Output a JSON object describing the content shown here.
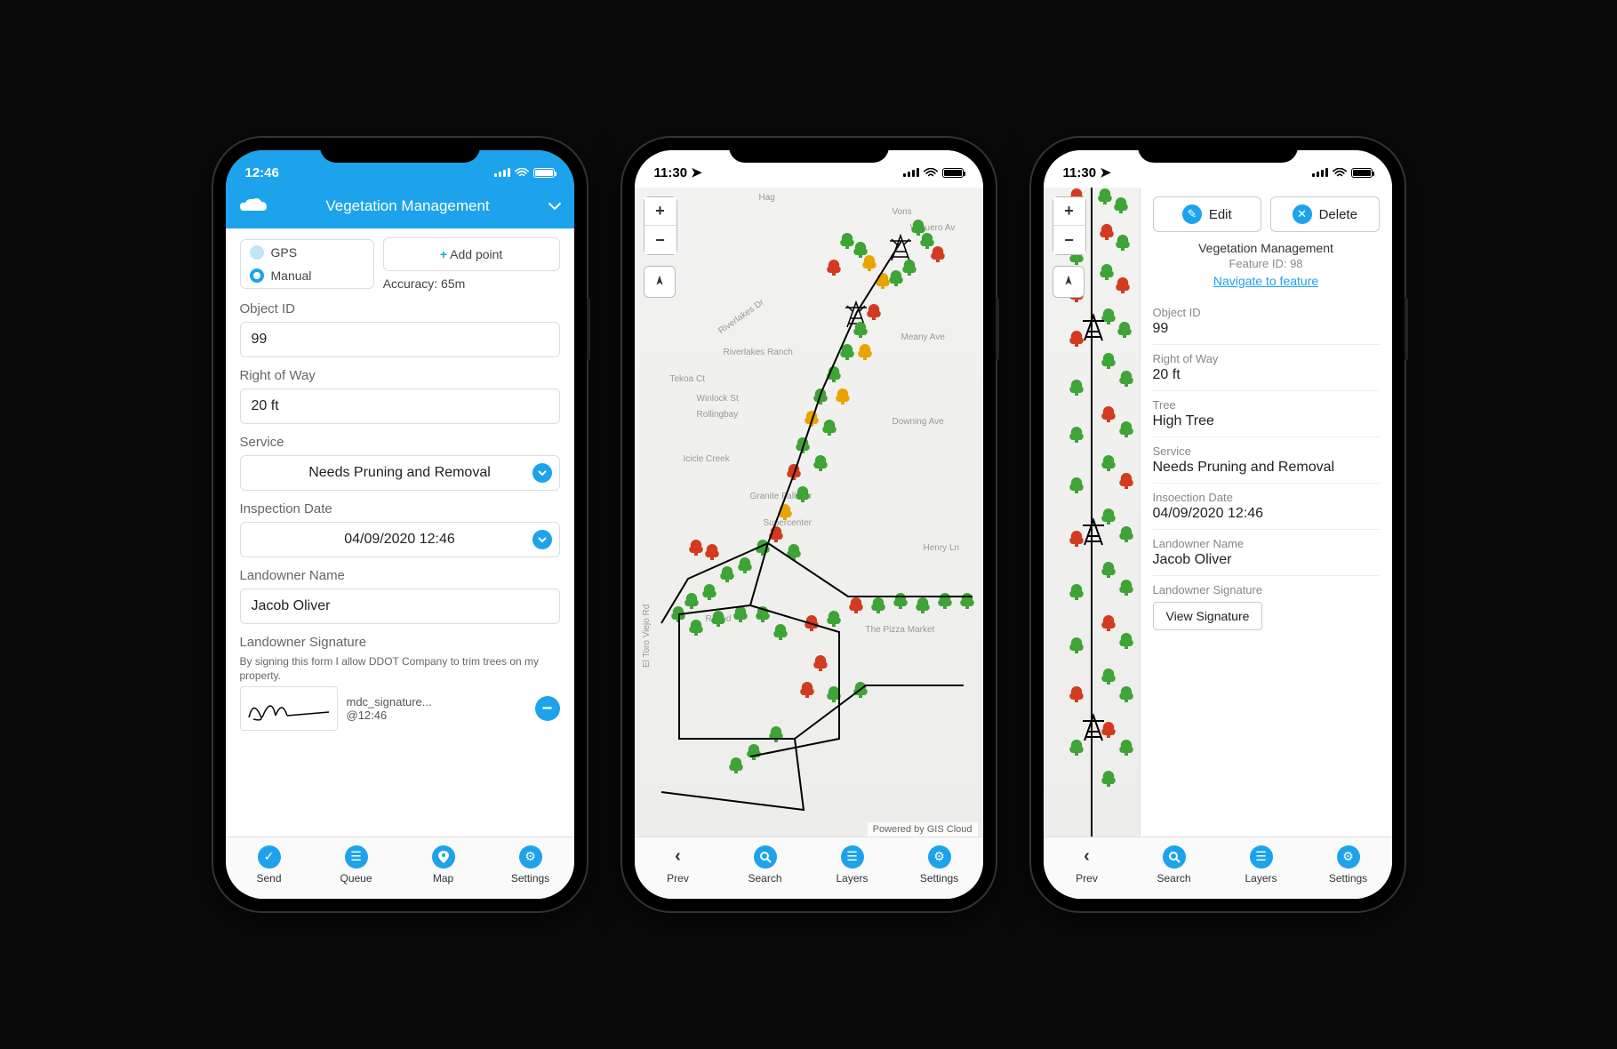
{
  "phone1": {
    "status_time": "12:46",
    "header_title": "Vegetation Management",
    "mode": {
      "gps": "GPS",
      "manual": "Manual"
    },
    "add_point": "+ Add point",
    "accuracy_label": "Accuracy: 65m",
    "fields": {
      "object_id_label": "Object ID",
      "object_id": "99",
      "row_label": "Right of Way",
      "row": "20 ft",
      "service_label": "Service",
      "service": "Needs Pruning and Removal",
      "insp_label": "Inspection Date",
      "insp": "04/09/2020 12:46",
      "owner_label": "Landowner Name",
      "owner": "Jacob Oliver",
      "sig_label": "Landowner Signature",
      "sig_hint": "By signing this form I allow DDOT Company to trim trees on my property.",
      "sig_file": "mdc_signature...",
      "sig_time": "@12:46"
    },
    "tabs": {
      "send": "Send",
      "queue": "Queue",
      "map": "Map",
      "settings": "Settings"
    }
  },
  "phone2": {
    "status_time": "11:30",
    "attribution": "Powered by GIS Cloud",
    "streets": {
      "hag": "Hag",
      "vons": "Vons",
      "vaquero": "Vaquero Av",
      "riverlakes": "Riverlakes Dr",
      "riverlakes_ranch": "Riverlakes Ranch",
      "tekoa": "Tekoa Ct",
      "winlock": "Winlock St",
      "rollingbay": "Rollingbay",
      "icicle": "Icicle Creek",
      "granite": "Granite Falls Dr",
      "supercenter": "Supercenter",
      "meany": "Meany Ave",
      "downing": "Downing Ave",
      "henry": "Henry Ln",
      "rosed": "Rosed",
      "pizza": "The Pizza Market",
      "eltoro": "El Toro Viejo Rd"
    },
    "tabs": {
      "prev": "Prev",
      "search": "Search",
      "layers": "Layers",
      "settings": "Settings"
    }
  },
  "phone3": {
    "status_time": "11:30",
    "actions": {
      "edit": "Edit",
      "delete": "Delete"
    },
    "panel": {
      "title": "Vegetation Management",
      "feature_id": "Feature ID: 98",
      "nav_link": "Navigate to feature",
      "object_id_label": "Object ID",
      "object_id": "99",
      "row_label": "Right of Way",
      "row": "20 ft",
      "tree_label": "Tree",
      "tree": "High Tree",
      "service_label": "Service",
      "service": "Needs Pruning and Removal",
      "insp_label": "Insoection Date",
      "insp": "04/09/2020  12:46",
      "owner_label": "Landowner Name",
      "owner": "Jacob Oliver",
      "sig_label": "Landowner Signature",
      "view_sig": "View Signature"
    },
    "tabs": {
      "prev": "Prev",
      "search": "Search",
      "layers": "Layers",
      "settings": "Settings"
    }
  },
  "colors": {
    "brand": "#1ca3ec",
    "tree_ok": "#3da435",
    "tree_warn": "#e9a400",
    "tree_bad": "#d23b1f"
  }
}
